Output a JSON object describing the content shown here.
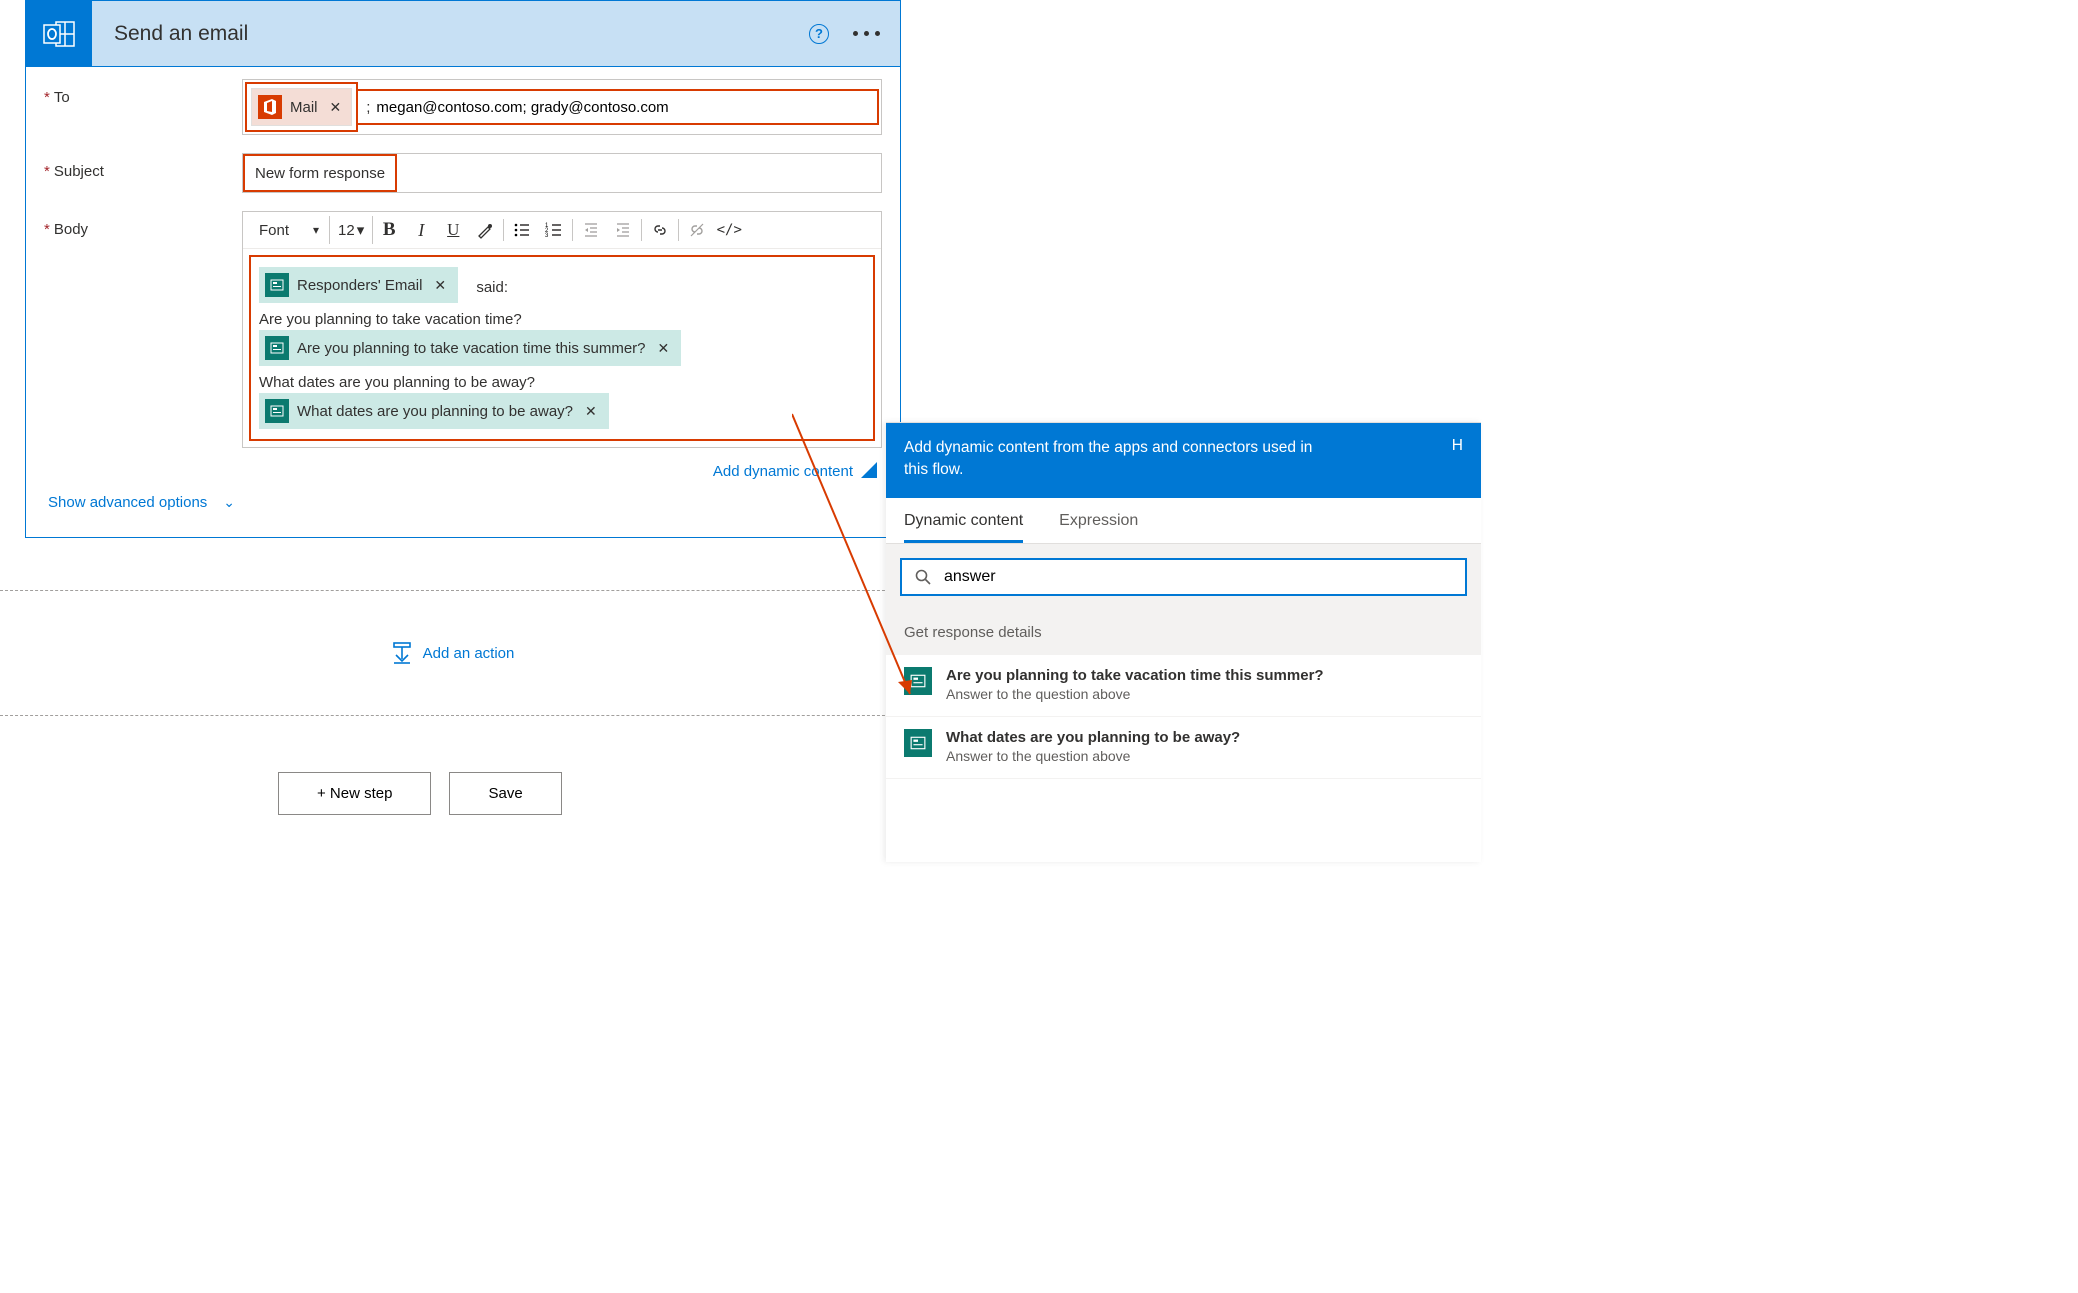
{
  "card": {
    "title": "Send an email",
    "helpTooltip": "?",
    "fields": {
      "toLabel": "To",
      "subjectLabel": "Subject",
      "bodyLabel": "Body"
    },
    "to": {
      "token": "Mail",
      "rest": "megan@contoso.com; grady@contoso.com"
    },
    "subject": "New form response",
    "body": {
      "tokenResponder": "Responders' Email",
      "saidText": "said:",
      "line1": "Are you planning to take vacation time?",
      "token1": "Are you planning to take vacation time this summer?",
      "line2": "What dates are you planning to be away?",
      "token2": "What dates are you planning to be away?"
    },
    "editorToolbar": {
      "fontLabel": "Font",
      "sizeLabel": "12"
    },
    "addDynamic": "Add dynamic content",
    "advanced": "Show advanced options"
  },
  "addAction": "Add an action",
  "buttons": {
    "newStep": "+ New step",
    "save": "Save"
  },
  "dynPanel": {
    "headerText": "Add dynamic content from the apps and connectors used in this flow.",
    "headerHelp": "H",
    "tabs": {
      "dynamic": "Dynamic content",
      "expression": "Expression"
    },
    "searchValue": "answer",
    "sectionTitle": "Get response details",
    "items": [
      {
        "title": "Are you planning to take vacation time this summer?",
        "sub": "Answer to the question above"
      },
      {
        "title": "What dates are you planning to be away?",
        "sub": "Answer to the question above"
      }
    ]
  }
}
